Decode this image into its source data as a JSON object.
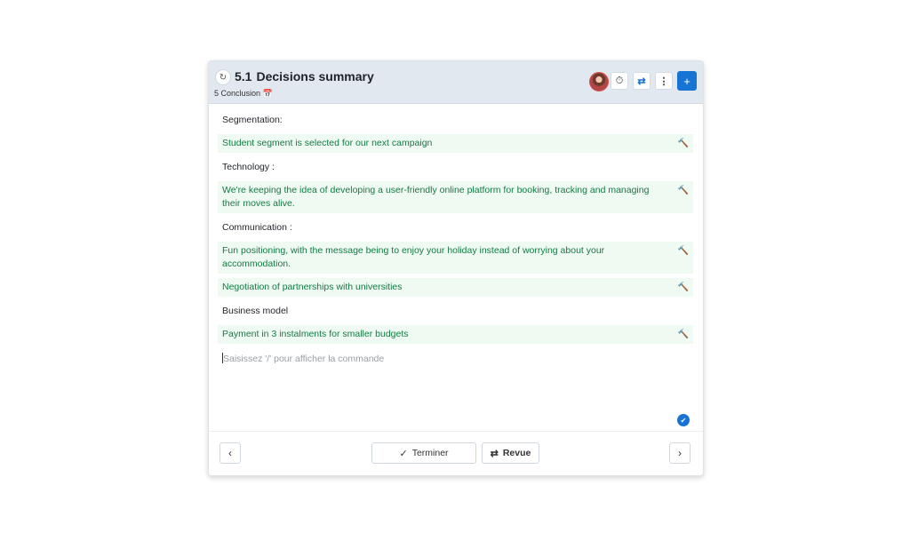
{
  "header": {
    "section_number": "5.1",
    "title": "Decisions summary",
    "breadcrumb": "5 Conclusion",
    "breadcrumb_icon": "calendar-icon",
    "buttons": [
      "timer-icon",
      "sync-icon",
      "more-icon",
      "add-icon"
    ],
    "add_label": "+"
  },
  "content": {
    "labels": [
      "Segmentation:",
      "Technology :",
      "Communication :",
      "Business model"
    ],
    "decisions": [
      "Student segment is selected for our next campaign",
      "We're keeping the idea of developing a user-friendly online platform for booking, tracking and managing their moves alive.",
      "Fun positioning, with the message being to enjoy your holiday instead of worrying about your accommodation.",
      "Negotiation of partnerships with universities",
      "Payment in 3 instalments for smaller budgets"
    ],
    "placeholder": "Saisissez '/' pour afficher la commande"
  },
  "footer": {
    "finish_label": "Terminer",
    "review_label": "Revue"
  },
  "colors": {
    "accent": "#1874d2",
    "decision_bg": "#eefaf2",
    "decision_text": "#167a43",
    "header_bg": "#e2e8f0"
  }
}
